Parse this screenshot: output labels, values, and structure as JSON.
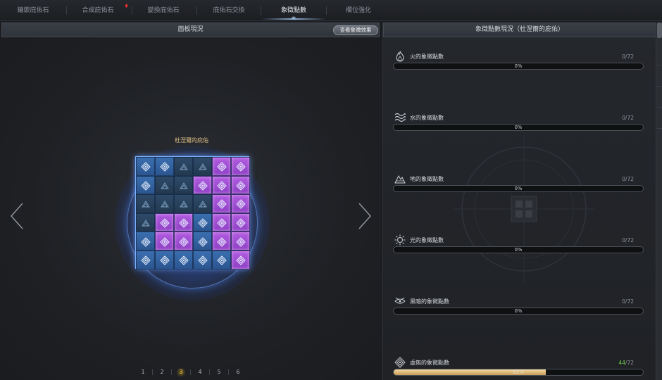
{
  "tabs": [
    {
      "label": "鑲嵌庇佑石"
    },
    {
      "label": "合成庇佑石"
    },
    {
      "label": "變換庇佑石"
    },
    {
      "label": "庇佑石交換"
    },
    {
      "label": "象徵點數"
    },
    {
      "label": "欄位強化"
    }
  ],
  "active_tab_index": 4,
  "left_panel": {
    "title": "面板現況",
    "view_effect_button": "查看象徵效果",
    "board_name": "杜涅爾的庇佑",
    "board": [
      [
        "b",
        "b",
        "d",
        "d",
        "p",
        "p"
      ],
      [
        "b",
        "d",
        "d",
        "p",
        "p",
        "p"
      ],
      [
        "d",
        "d",
        "d",
        "d",
        "p",
        "p"
      ],
      [
        "d",
        "p",
        "p",
        "b",
        "p",
        "p"
      ],
      [
        "b",
        "p",
        "p",
        "b",
        "p",
        "p"
      ],
      [
        "b",
        "b",
        "b",
        "b",
        "b",
        "p"
      ]
    ],
    "pages": [
      "1",
      "2",
      "3",
      "4",
      "5",
      "6"
    ],
    "active_page": "3"
  },
  "right_panel": {
    "title": "象徵點數現況（杜涅爾的庇佑）",
    "symbols": [
      {
        "icon": "fire-symbol-icon",
        "label": "火的象徵點數",
        "current": "0",
        "max": "/72",
        "percent_text": "0%",
        "fill": 0,
        "highlight": false
      },
      {
        "icon": "water-symbol-icon",
        "label": "水的象徵點數",
        "current": "0",
        "max": "/72",
        "percent_text": "0%",
        "fill": 0,
        "highlight": false
      },
      {
        "icon": "earth-symbol-icon",
        "label": "地的象徵點數",
        "current": "0",
        "max": "/72",
        "percent_text": "0%",
        "fill": 0,
        "highlight": false
      },
      {
        "icon": "light-symbol-icon",
        "label": "光的象徵點數",
        "current": "0",
        "max": "/72",
        "percent_text": "0%",
        "fill": 0,
        "highlight": false
      },
      {
        "icon": "dark-symbol-icon",
        "label": "黑暗的象徵點數",
        "current": "0",
        "max": "/72",
        "percent_text": "0%",
        "fill": 0,
        "highlight": false
      },
      {
        "icon": "void-symbol-icon",
        "label": "虛無的象徵點數",
        "current": "44",
        "max": "/72",
        "percent_text": "61%",
        "fill": 0.61,
        "highlight": true
      }
    ]
  },
  "colors": {
    "accent_gold": "#e0c38a",
    "progress_fill": "#c99a55",
    "count_green": "#6ccd4a",
    "tile_purple": "#b25ce0",
    "tile_blue": "#3b6fb0"
  }
}
